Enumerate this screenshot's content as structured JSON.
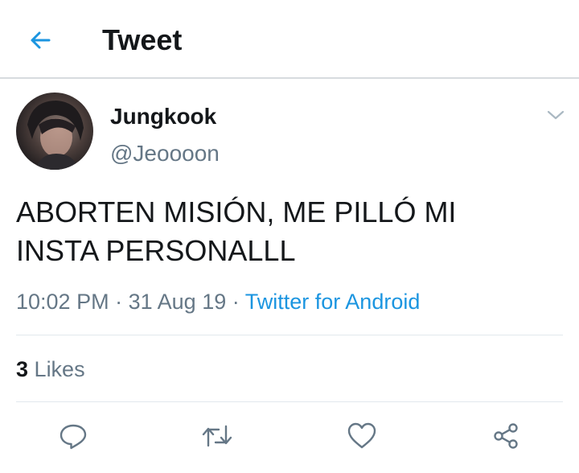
{
  "header": {
    "title": "Tweet",
    "back_icon": "back-arrow-icon"
  },
  "author": {
    "name": "Jungkook",
    "handle": "@Jeoooon"
  },
  "tweet": {
    "text": "ABORTEN MISIÓN, ME PILLÓ MI\nINSTA PERSONALLL",
    "time": "10:02 PM",
    "date": "31 Aug 19",
    "separator": "·",
    "source": "Twitter for Android"
  },
  "stats": {
    "likes_count": "3",
    "likes_label": "Likes"
  },
  "actions": [
    "reply-icon",
    "retweet-icon",
    "like-icon",
    "share-icon"
  ],
  "colors": {
    "accent": "#1b95e0",
    "text": "#14171a",
    "secondary": "#657786",
    "divider": "#e1e8ed"
  }
}
